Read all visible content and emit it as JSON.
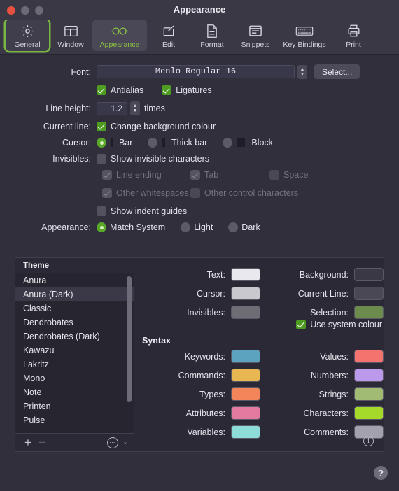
{
  "window": {
    "title": "Appearance",
    "traffic_lights": [
      "close",
      "minimize",
      "maximize"
    ]
  },
  "toolbar": {
    "items": [
      {
        "label": "General",
        "icon": "gear-icon",
        "state": "focused"
      },
      {
        "label": "Window",
        "icon": "window-layout-icon",
        "state": "normal"
      },
      {
        "label": "Appearance",
        "icon": "glasses-icon",
        "state": "selected"
      },
      {
        "label": "Edit",
        "icon": "pencil-square-icon",
        "state": "normal"
      },
      {
        "label": "Format",
        "icon": "document-icon",
        "state": "normal"
      },
      {
        "label": "Snippets",
        "icon": "snippet-lines-icon",
        "state": "normal"
      },
      {
        "label": "Key Bindings",
        "icon": "keyboard-icon",
        "state": "normal"
      },
      {
        "label": "Print",
        "icon": "printer-icon",
        "state": "normal"
      }
    ]
  },
  "form": {
    "font": {
      "label": "Font:",
      "value": "Menlo Regular 16",
      "select_button": "Select...",
      "antialias": {
        "label": "Antialias",
        "checked": true
      },
      "ligatures": {
        "label": "Ligatures",
        "checked": true
      }
    },
    "line_height": {
      "label": "Line height:",
      "value": "1.2",
      "unit": "times"
    },
    "current_line": {
      "label": "Current line:",
      "option": "Change background colour",
      "checked": true
    },
    "cursor": {
      "label": "Cursor:",
      "options": [
        {
          "label": "Bar",
          "mark": "bar-glyph",
          "selected": true
        },
        {
          "label": "Thick bar",
          "mark": "thick-bar-glyph",
          "selected": false
        },
        {
          "label": "Block",
          "mark": "block-glyph",
          "selected": false
        }
      ]
    },
    "invisibles": {
      "label": "Invisibles:",
      "show": {
        "label": "Show invisible characters",
        "checked": false
      },
      "sub_options": [
        {
          "label": "Line ending",
          "checked": true,
          "enabled": false
        },
        {
          "label": "Tab",
          "checked": true,
          "enabled": false
        },
        {
          "label": "Space",
          "checked": false,
          "enabled": false
        },
        {
          "label": "Other whitespaces",
          "checked": true,
          "enabled": false
        },
        {
          "label": "Other control characters",
          "checked": false,
          "enabled": false
        }
      ],
      "indent_guides": {
        "label": "Show indent guides",
        "checked": false
      }
    },
    "appearance": {
      "label": "Appearance:",
      "options": [
        {
          "label": "Match System",
          "selected": true
        },
        {
          "label": "Light",
          "selected": false
        },
        {
          "label": "Dark",
          "selected": false
        }
      ]
    }
  },
  "theme_panel": {
    "column_header": "Theme",
    "items": [
      {
        "name": "Anura",
        "selected": false
      },
      {
        "name": "Anura (Dark)",
        "selected": true
      },
      {
        "name": "Classic",
        "selected": false
      },
      {
        "name": "Dendrobates",
        "selected": false
      },
      {
        "name": "Dendrobates (Dark)",
        "selected": false
      },
      {
        "name": "Kawazu",
        "selected": false
      },
      {
        "name": "Lakritz",
        "selected": false
      },
      {
        "name": "Mono",
        "selected": false
      },
      {
        "name": "Note",
        "selected": false
      },
      {
        "name": "Printen",
        "selected": false
      },
      {
        "name": "Pulse",
        "selected": false
      }
    ],
    "footer": {
      "add": "+",
      "remove": "−",
      "actions": "⋯",
      "chevron": "⌄"
    }
  },
  "colors": {
    "general_left": [
      {
        "label": "Text:",
        "value": "#e8e8ee"
      },
      {
        "label": "Cursor:",
        "value": "#c9c8cf"
      },
      {
        "label": "Invisibles:",
        "value": "#6e6c74"
      }
    ],
    "general_right": [
      {
        "label": "Background:",
        "value": "#3a3844"
      },
      {
        "label": "Current Line:",
        "value": "#4a4854"
      },
      {
        "label": "Selection:",
        "value": "#6c8b4c"
      }
    ],
    "use_system_colour": {
      "label": "Use system colour",
      "checked": true
    },
    "syntax_heading": "Syntax",
    "syntax_left": [
      {
        "label": "Keywords:",
        "value": "#5ba3bf"
      },
      {
        "label": "Commands:",
        "value": "#e8b752"
      },
      {
        "label": "Types:",
        "value": "#f2865a"
      },
      {
        "label": "Attributes:",
        "value": "#e37a9f"
      },
      {
        "label": "Variables:",
        "value": "#8ddcd8"
      }
    ],
    "syntax_right": [
      {
        "label": "Values:",
        "value": "#f4736e"
      },
      {
        "label": "Numbers:",
        "value": "#bb9aec"
      },
      {
        "label": "Strings:",
        "value": "#a2bb72"
      },
      {
        "label": "Characters:",
        "value": "#a5da2b"
      },
      {
        "label": "Comments:",
        "value": "#a3a1ab"
      }
    ],
    "info_icon": "i"
  },
  "help": {
    "label": "?"
  }
}
